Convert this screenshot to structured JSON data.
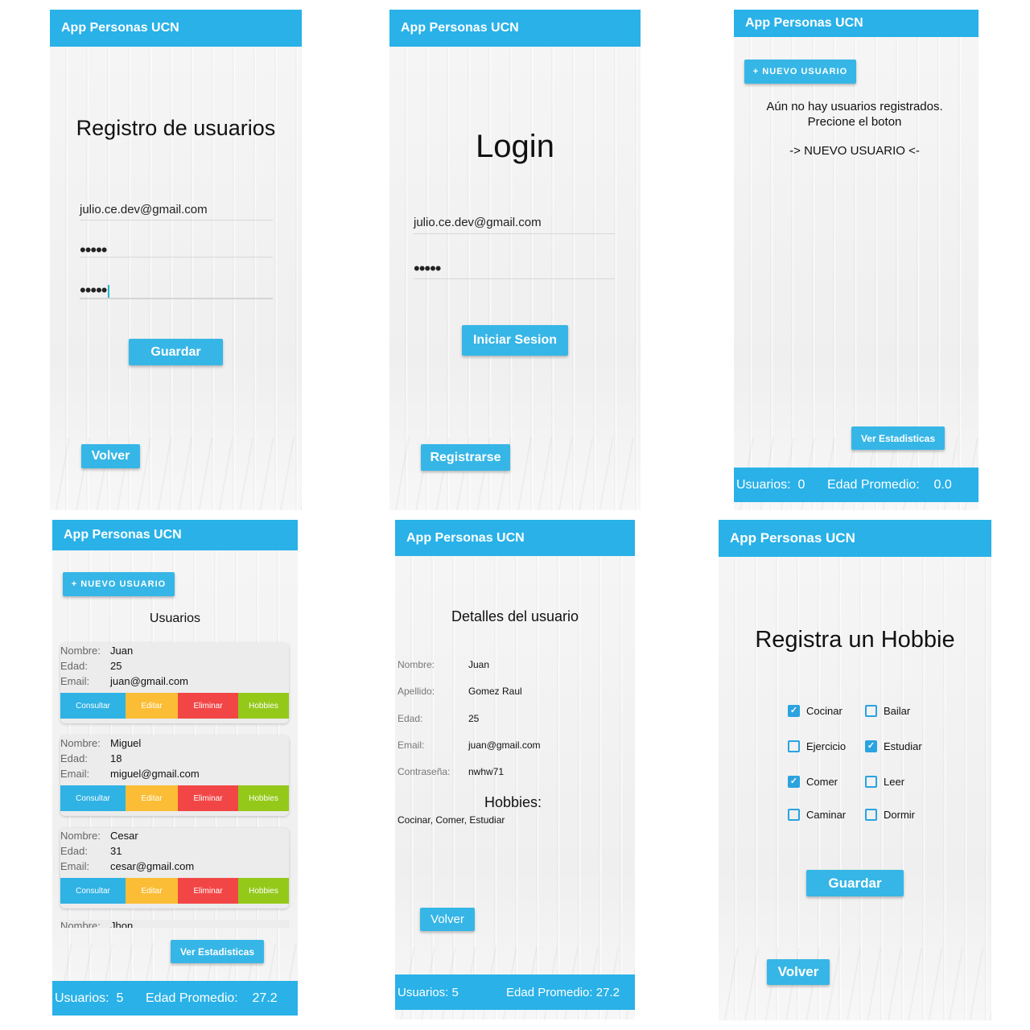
{
  "app_title": "App Personas UCN",
  "registro": {
    "heading": "Registro de usuarios",
    "email_value": "julio.ce.dev@gmail.com",
    "password_value": "•••••",
    "confirm_value": "•••••",
    "save_label": "Guardar",
    "back_label": "Volver"
  },
  "login": {
    "heading": "Login",
    "email_value": "julio.ce.dev@gmail.com",
    "password_value": "•••••",
    "login_label": "Iniciar Sesion",
    "register_label": "Registrarse"
  },
  "empty_list": {
    "new_user_label": "+ NUEVO USUARIO",
    "empty_line1": "Aún no hay usuarios registrados.",
    "empty_line2": "Precione el boton",
    "empty_line3": "-> NUEVO USUARIO <-",
    "stats_label": "Ver Estadisticas",
    "footer_users": "Usuarios:  0",
    "footer_age": "Edad Promedio:    0.0"
  },
  "user_list": {
    "new_user_label": "+ NUEVO USUARIO",
    "heading": "Usuarios",
    "labels": {
      "name": "Nombre:",
      "age": "Edad:",
      "email": "Email:"
    },
    "actions": {
      "consult": "Consultar",
      "edit": "Editar",
      "delete": "Eliminar",
      "hobbies": "Hobbies"
    },
    "users": [
      {
        "name": "Juan",
        "age": "25",
        "email": "juan@gmail.com"
      },
      {
        "name": "Miguel",
        "age": "18",
        "email": "miguel@gmail.com"
      },
      {
        "name": "Cesar",
        "age": "31",
        "email": "cesar@gmail.com"
      },
      {
        "name": "Jhon"
      }
    ],
    "stats_label": "Ver Estadisticas",
    "footer_users": "Usuarios:  5",
    "footer_age": "Edad Promedio:    27.2"
  },
  "details": {
    "heading": "Detalles del usuario",
    "fields": [
      {
        "label": "Nombre:",
        "value": "Juan"
      },
      {
        "label": "Apellido:",
        "value": "Gomez Raul"
      },
      {
        "label": "Edad:",
        "value": "25"
      },
      {
        "label": "Email:",
        "value": "juan@gmail.com"
      },
      {
        "label": "Contraseña:",
        "value": "nwhw71"
      }
    ],
    "hobbies_heading": "Hobbies:",
    "hobbies_value": "Cocinar, Comer, Estudiar",
    "back_label": "Volver",
    "footer_users": "Usuarios: 5",
    "footer_age": "Edad Promedio: 27.2"
  },
  "hobbies": {
    "heading": "Registra un Hobbie",
    "options": [
      {
        "label": "Cocinar",
        "checked": true
      },
      {
        "label": "Bailar",
        "checked": false
      },
      {
        "label": "Ejercicio",
        "checked": false
      },
      {
        "label": "Estudiar",
        "checked": true
      },
      {
        "label": "Comer",
        "checked": true
      },
      {
        "label": "Leer",
        "checked": false
      },
      {
        "label": "Caminar",
        "checked": false
      },
      {
        "label": "Dormir",
        "checked": false
      }
    ],
    "save_label": "Guardar",
    "back_label": "Volver"
  },
  "colors": {
    "primary": "#29b1e8",
    "button": "#36b6e6",
    "consult": "#2fb2e4",
    "edit": "#fbbd35",
    "delete": "#f24646",
    "hobbies": "#94c91a"
  },
  "icons": {
    "check": "check-icon",
    "checkbox": "checkbox-icon"
  }
}
